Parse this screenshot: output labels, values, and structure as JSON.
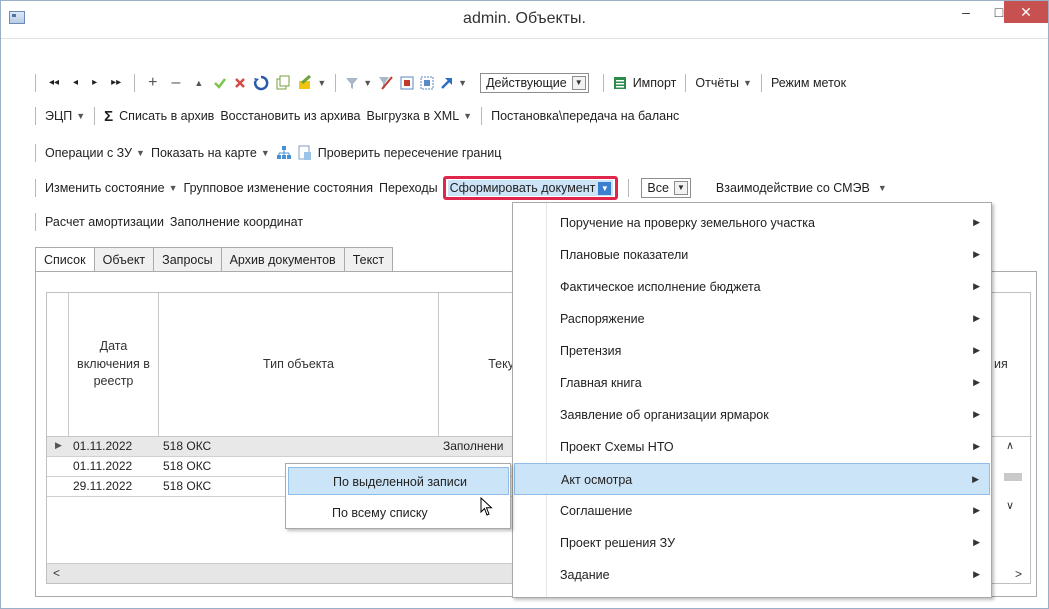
{
  "window": {
    "title": "admin. Объекты.",
    "minimize": "–",
    "maximize": "□",
    "close": "✕"
  },
  "toolbar": {
    "row1": {
      "nav_first": "◂◂",
      "nav_prev": "◂",
      "nav_next": "▸",
      "nav_last": "▸▸",
      "add": "+",
      "remove": "–",
      "up": "▲",
      "filter_combo": "Действующие",
      "import": "Импорт",
      "reports": "Отчёты",
      "mark_mode": "Режим меток"
    },
    "row2": {
      "ecp": "ЭЦП",
      "sigma": "Σ",
      "archive": "Списать в архив",
      "restore": "Восстановить из архива",
      "xml_export": "Выгрузка в XML",
      "balance": "Постановка\\передача на баланс"
    },
    "row3": {
      "land_ops": "Операции с ЗУ",
      "show_map": "Показать на карте",
      "check_borders": "Проверить пересечение границ"
    },
    "row4": {
      "change_state": "Изменить состояние",
      "group_change": "Групповое изменение состояния",
      "transitions": "Переходы",
      "form_document": "Сформировать документ",
      "all_combo": "Все",
      "smev": "Взаимодействие со СМЭВ"
    },
    "row5": {
      "depreciation": "Расчет амортизации",
      "coords": "Заполнение координат"
    }
  },
  "tabs": [
    "Список",
    "Объект",
    "Запросы",
    "Архив документов",
    "Текст"
  ],
  "grid": {
    "headers": {
      "date": "Дата включения в реестр",
      "type": "Тип объекта",
      "current": "Теку",
      "tail": "ия"
    },
    "rows": [
      {
        "date": "01.11.2022",
        "type": "518 ОКС",
        "current": "Заполнени"
      },
      {
        "date": "01.11.2022",
        "type": "518 ОКС",
        "current": ""
      },
      {
        "date": "29.11.2022",
        "type": "518 ОКС",
        "current": ""
      }
    ]
  },
  "menu": {
    "items": [
      "Поручение на проверку земельного участка",
      "Плановые показатели",
      "Фактическое исполнение бюджета",
      "Распоряжение",
      "Претензия",
      "Главная книга",
      "Заявление об организации ярмарок",
      "Проект Схемы НТО",
      "Акт осмотра",
      "Соглашение",
      "Проект решения ЗУ",
      "Задание"
    ],
    "hovered_index": 8
  },
  "submenu": {
    "items": [
      "По выделенной записи",
      "По всему списку"
    ],
    "hovered_index": 0
  },
  "colors": {
    "highlight_border": "#e0264a",
    "menu_hover": "#cce4f7",
    "close_button": "#c75050"
  }
}
